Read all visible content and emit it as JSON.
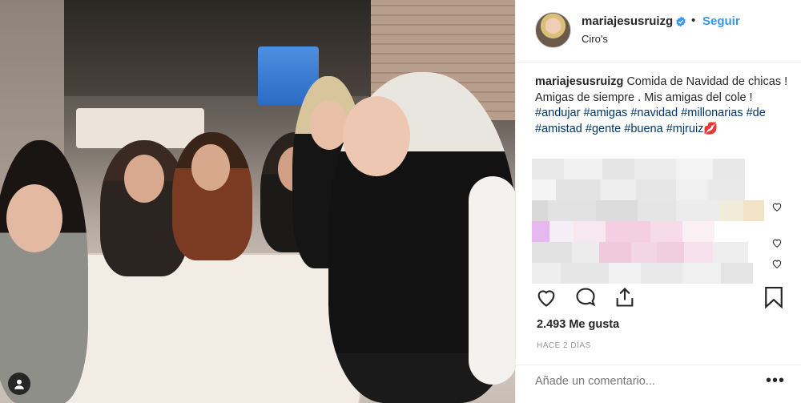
{
  "post": {
    "username": "mariajesusruizg",
    "verified": true,
    "separator": "•",
    "follow_label": "Seguir",
    "location": "Ciro's",
    "caption": {
      "username": "mariajesusruizg",
      "text": " Comida de Navidad de chicas ! Amigas de siempre . Mis amigas del cole ! ",
      "hashtags": [
        "#andujar",
        "#amigas",
        "#navidad",
        "#millonarias",
        "#de",
        "#amistad",
        "#gente",
        "#buena",
        "#mjruiz"
      ],
      "emoji": "💋"
    },
    "likes": "2.493 Me gusta",
    "timestamp": "HACE 2 DÍAS",
    "comment_placeholder": "Añade un comentario...",
    "more_label": "•••"
  },
  "icons": {
    "like": "heart-outline-icon",
    "comment": "speech-bubble-icon",
    "share": "share-icon",
    "save": "bookmark-icon",
    "verified": "verified-badge-icon",
    "tagged": "person-tag-icon"
  },
  "colors": {
    "link": "#3897f0",
    "hashtag": "#003569",
    "text": "#262626",
    "muted": "#999999"
  }
}
